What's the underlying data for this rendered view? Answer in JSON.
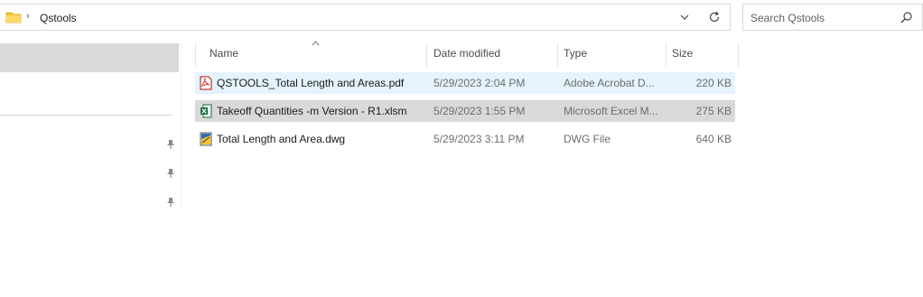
{
  "address": {
    "breadcrumb": "Qstools",
    "separator": "›"
  },
  "search": {
    "placeholder": "Search Qstools"
  },
  "columns": {
    "name": "Name",
    "date": "Date modified",
    "type": "Type",
    "size": "Size"
  },
  "files": [
    {
      "name": "QSTOOLS_Total Length and Areas.pdf",
      "date": "5/29/2023 2:04 PM",
      "type": "Adobe Acrobat D...",
      "size": "220 KB",
      "icon": "pdf-file-icon"
    },
    {
      "name": "Takeoff Quantities -m Version - R1.xlsm",
      "date": "5/29/2023 1:55 PM",
      "type": "Microsoft Excel M...",
      "size": "275 KB",
      "icon": "excel-file-icon"
    },
    {
      "name": "Total Length and Area.dwg",
      "date": "5/29/2023 3:11 PM",
      "type": "DWG File",
      "size": "640 KB",
      "icon": "dwg-file-icon"
    }
  ],
  "colors": {
    "hover_row": "#e5f3ff",
    "selected_row": "#d9d9d9",
    "folder": "#f4c430"
  }
}
